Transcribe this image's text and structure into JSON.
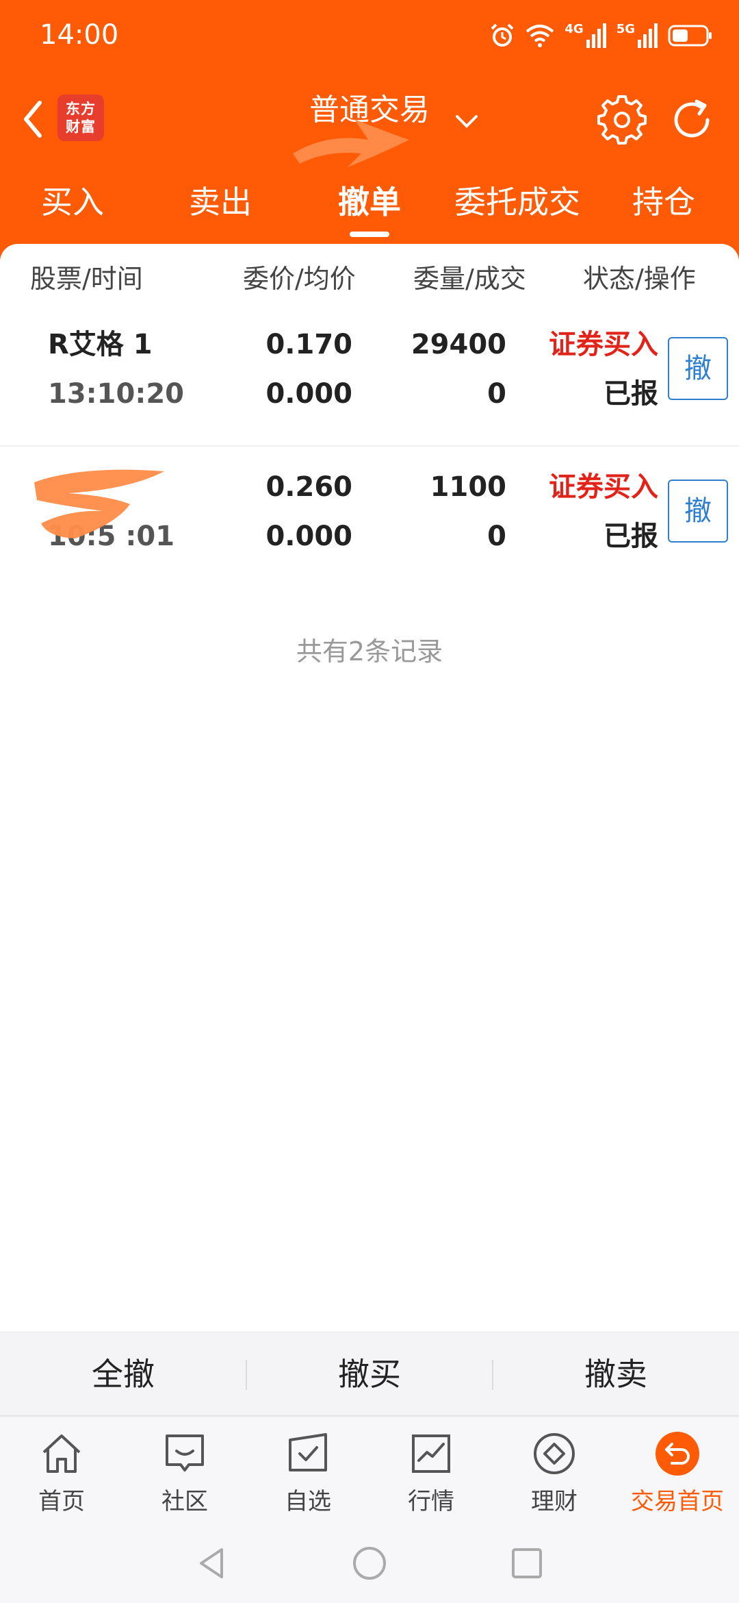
{
  "status_bar": {
    "time": "14:00",
    "network_1": "4G",
    "network_2": "5G",
    "icons": [
      "alarm-icon",
      "wifi-icon",
      "signal-icon",
      "signal-icon",
      "battery-icon"
    ]
  },
  "header": {
    "logo_text_line1": "东方",
    "logo_text_line2": "财富",
    "title": "普通交易",
    "subtitle": "",
    "accent_color": "#ff5a05"
  },
  "tabs": [
    {
      "label": "买入"
    },
    {
      "label": "卖出"
    },
    {
      "label": "撤单",
      "active": true
    },
    {
      "label": "委托成交"
    },
    {
      "label": "持仓"
    }
  ],
  "table": {
    "columns": [
      "股票/时间",
      "委价/均价",
      "委量/成交",
      "状态/操作"
    ],
    "rows": [
      {
        "name": "R艾格 1",
        "time": "13:10:20",
        "order_price": "0.170",
        "avg_price": "0.000",
        "order_qty": "29400",
        "filled_qty": "0",
        "type": "证券买入",
        "status": "已报",
        "action": "撤"
      },
      {
        "name": "",
        "time": "10:5 :01",
        "order_price": "0.260",
        "avg_price": "0.000",
        "order_qty": "1100",
        "filled_qty": "0",
        "type": "证券买入",
        "status": "已报",
        "action": "撤"
      }
    ],
    "record_count": "共有2条记录"
  },
  "actions": {
    "cancel_all": "全撤",
    "cancel_buy": "撤买",
    "cancel_sell": "撤卖"
  },
  "bottom_nav": [
    {
      "label": "首页",
      "icon": "home-icon"
    },
    {
      "label": "社区",
      "icon": "chat-icon"
    },
    {
      "label": "自选",
      "icon": "watchlist-icon"
    },
    {
      "label": "行情",
      "icon": "chart-icon"
    },
    {
      "label": "理财",
      "icon": "diamond-icon"
    },
    {
      "label": "交易首页",
      "icon": "trade-icon",
      "active": true
    }
  ]
}
